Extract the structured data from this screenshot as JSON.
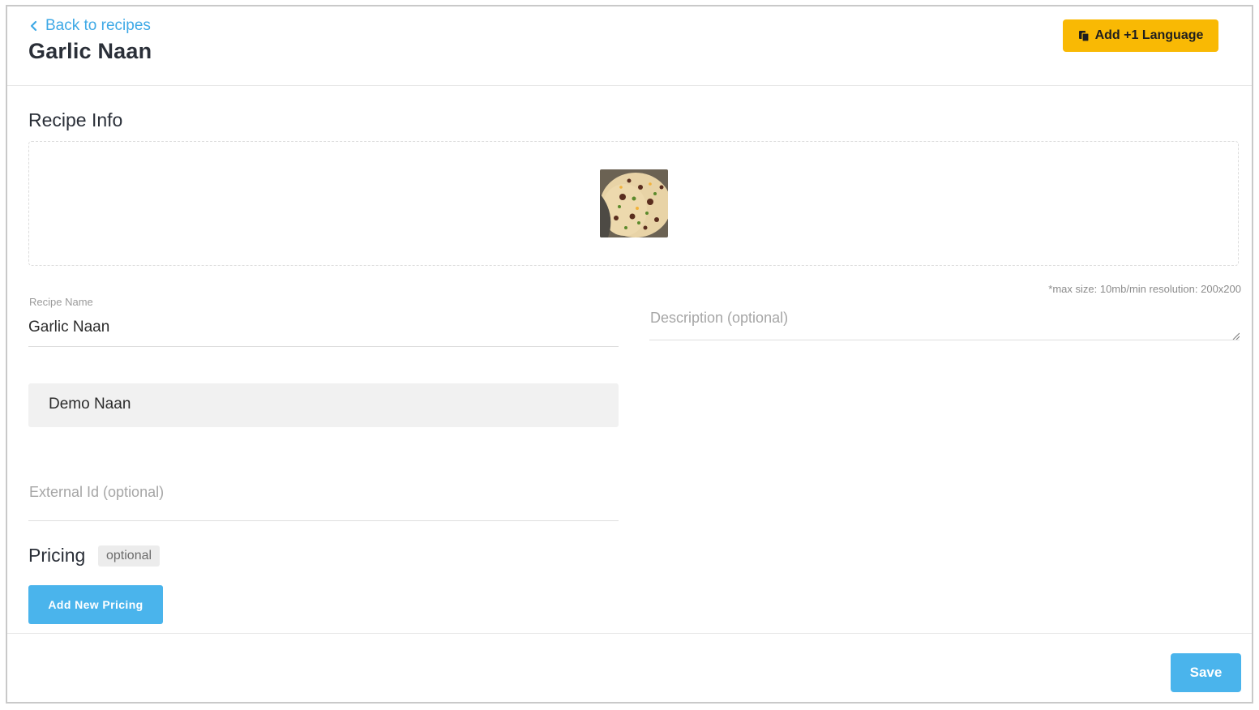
{
  "header": {
    "back_label": "Back to recipes",
    "title": "Garlic Naan",
    "add_language_label": "Add +1 Language"
  },
  "recipe_info": {
    "section_title": "Recipe Info",
    "upload_hint": "*max size: 10mb/min resolution: 200x200",
    "image_icon": "naan-photo",
    "recipe_name_label": "Recipe Name",
    "recipe_name_value": "Garlic Naan",
    "description_placeholder": "Description (optional)",
    "category_value": "Demo Naan",
    "external_id_placeholder": "External Id (optional)"
  },
  "pricing": {
    "section_title": "Pricing",
    "badge": "optional",
    "add_button_label": "Add New Pricing"
  },
  "footer": {
    "save_label": "Save"
  },
  "colors": {
    "accent_blue": "#4ab4ec",
    "link_blue": "#3fa9e6",
    "language_button": "#f9b904"
  }
}
